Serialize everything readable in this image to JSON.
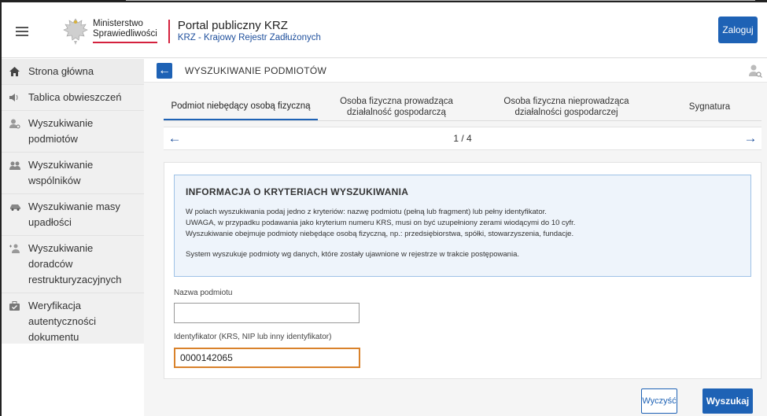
{
  "header": {
    "ministry_line1": "Ministerstwo",
    "ministry_line2": "Sprawiedliwości",
    "portal_title": "Portal publiczny KRZ",
    "portal_subtitle": "KRZ - Krajowy Rejestr Zadłużonych",
    "login_label": "Zaloguj"
  },
  "sidebar": {
    "items": [
      {
        "label": "Strona główna",
        "icon": "home-icon"
      },
      {
        "label": "Tablica obwieszczeń",
        "icon": "megaphone-icon"
      },
      {
        "label": "Wyszukiwanie podmiotów",
        "icon": "person-search-icon"
      },
      {
        "label": "Wyszukiwanie wspólników",
        "icon": "people-icon"
      },
      {
        "label": "Wyszukiwanie masy upadłości",
        "icon": "car-icon"
      },
      {
        "label": "Wyszukiwanie doradców restrukturyzacyjnych",
        "icon": "advisor-icon"
      },
      {
        "label": "Weryfikacja autentyczności dokumentu",
        "icon": "briefcase-check-icon"
      }
    ]
  },
  "page": {
    "title": "WYSZUKIWANIE PODMIOTÓW"
  },
  "tabs": [
    {
      "label": "Podmiot niebędący osobą fizyczną",
      "active": true
    },
    {
      "label": "Osoba fizyczna prowadząca działalność gospodarczą",
      "active": false
    },
    {
      "label": "Osoba fizyczna nieprowadząca działalności gospodarczej",
      "active": false
    },
    {
      "label": "Sygnatura",
      "active": false
    }
  ],
  "pager": {
    "indicator": "1 / 4"
  },
  "info": {
    "title": "INFORMACJA O KRYTERIACH WYSZUKIWANIA",
    "line1": "W polach wyszukiwania podaj jedno z kryteriów: nazwę podmiotu (pełną lub fragment) lub pełny identyfikator.",
    "line2": "UWAGA, w przypadku podawania jako kryterium numeru KRS, musi on być uzupełniony zerami wiodącymi do 10 cyfr.",
    "line3": "Wyszukiwanie obejmuje podmioty niebędące osobą fizyczną, np.: przedsiębiorstwa, spółki, stowarzyszenia, fundacje.",
    "line4": "System wyszukuje podmioty wg danych, które zostały ujawnione w rejestrze w trakcie postępowania."
  },
  "form": {
    "name_label": "Nazwa podmiotu",
    "name_value": "",
    "id_label": "Identyfikator (KRS, NIP lub inny identyfikator)",
    "id_value": "0000142065"
  },
  "actions": {
    "clear_label": "Wyczyść",
    "search_label": "Wyszukaj"
  },
  "colors": {
    "accent": "#1e62b5",
    "brand_red": "#d4213d",
    "focus": "#d9822b"
  }
}
